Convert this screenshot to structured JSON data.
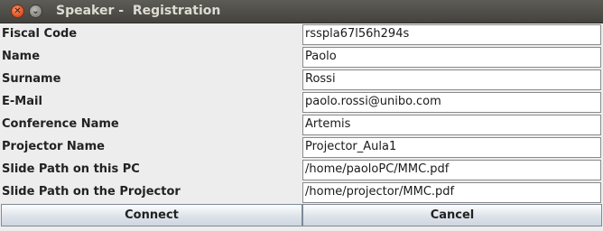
{
  "window": {
    "title": "Speaker -  Registration",
    "close_glyph": "✕",
    "minimize_glyph": "⌄"
  },
  "form": {
    "fields": [
      {
        "label": "Fiscal Code",
        "value": "rsspla67l56h294s"
      },
      {
        "label": "Name",
        "value": "Paolo"
      },
      {
        "label": "Surname",
        "value": "Rossi"
      },
      {
        "label": "E-Mail",
        "value": "paolo.rossi@unibo.com"
      },
      {
        "label": "Conference Name",
        "value": "Artemis"
      },
      {
        "label": "Projector Name",
        "value": "Projector_Aula1"
      },
      {
        "label": "Slide Path on this PC",
        "value": "/home/paoloPC/MMC.pdf"
      },
      {
        "label": "Slide Path on the Projector",
        "value": "/home/projector/MMC.pdf"
      }
    ]
  },
  "buttons": {
    "connect_label": "Connect",
    "cancel_label": "Cancel"
  }
}
